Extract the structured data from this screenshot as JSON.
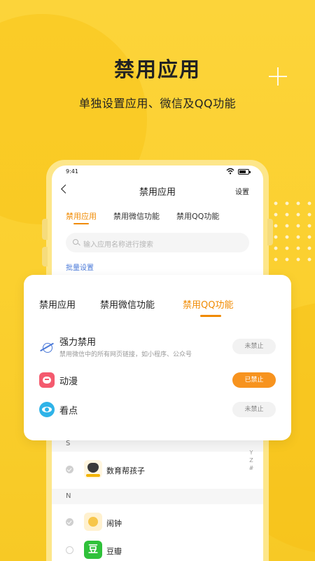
{
  "hero": {
    "title": "禁用应用",
    "subtitle": "单独设置应用、微信及QQ功能"
  },
  "phone": {
    "status_time": "9:41",
    "nav": {
      "title": "禁用应用",
      "settings": "设置"
    },
    "tabs": [
      "禁用应用",
      "禁用微信功能",
      "禁用QQ功能"
    ],
    "active_tab": "禁用应用",
    "search_placeholder": "输入应用名称进行搜索",
    "batch_label": "批量设置",
    "sections": [
      {
        "letter": "S",
        "apps": [
          {
            "name": "数育帮孩子",
            "icon": "owl-icon",
            "checked": true
          }
        ]
      },
      {
        "letter": "N",
        "apps": [
          {
            "name": "闹钟",
            "icon": "clock-icon",
            "checked": true
          },
          {
            "name": "豆瓣",
            "icon": "douban-icon",
            "icon_text": "豆",
            "checked": false
          }
        ]
      }
    ],
    "alpha_index": [
      "Y",
      "Z",
      "#"
    ]
  },
  "card": {
    "tabs": [
      "禁用应用",
      "禁用微信功能",
      "禁用QQ功能"
    ],
    "active_tab": "禁用QQ功能",
    "rows": [
      {
        "title": "强力禁用",
        "desc": "禁用微信中的所有网页链接，如小程序、公众号",
        "status": "未禁止",
        "on": false,
        "icon": "planet-icon"
      },
      {
        "title": "动漫",
        "status": "已禁止",
        "on": true,
        "icon": "anime-icon"
      },
      {
        "title": "看点",
        "status": "未禁止",
        "on": false,
        "icon": "eye-icon"
      }
    ]
  },
  "colors": {
    "accent": "#f08a00",
    "pill_on": "#f7931e",
    "background": "#fbd233",
    "link": "#4a79d8"
  }
}
